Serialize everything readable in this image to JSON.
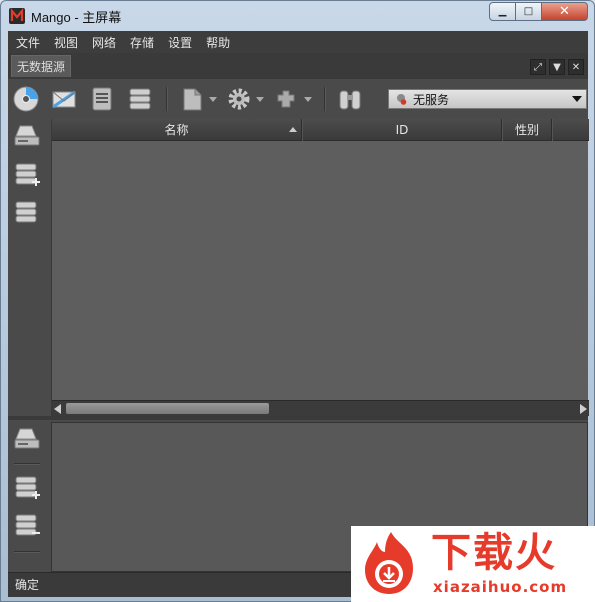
{
  "window": {
    "title": "Mango - 主屏幕",
    "minimize_glyph": "▁",
    "maximize_glyph": "□",
    "close_glyph": "✕"
  },
  "menu": {
    "items": [
      "文件",
      "视图",
      "网络",
      "存储",
      "设置",
      "帮助"
    ]
  },
  "document_tab": {
    "label": "无数据源",
    "controls": [
      "⤢",
      "▼",
      "✕"
    ]
  },
  "toolbar": {
    "icons": [
      "disc-icon",
      "mail-icon",
      "document-list-icon",
      "database-icon",
      "file-icon",
      "settings-gear-icon",
      "plugin-icon",
      "binoculars-icon"
    ],
    "service_select": {
      "value": "无服务"
    }
  },
  "grid": {
    "columns": [
      "名称",
      "ID",
      "性别"
    ],
    "rows": []
  },
  "status": {
    "text": "确定"
  },
  "watermark": {
    "text": "下载火",
    "subtext": "xiazaihuo.com"
  },
  "colors": {
    "background": "#4a4a4a",
    "accent": "#e63a2a"
  }
}
